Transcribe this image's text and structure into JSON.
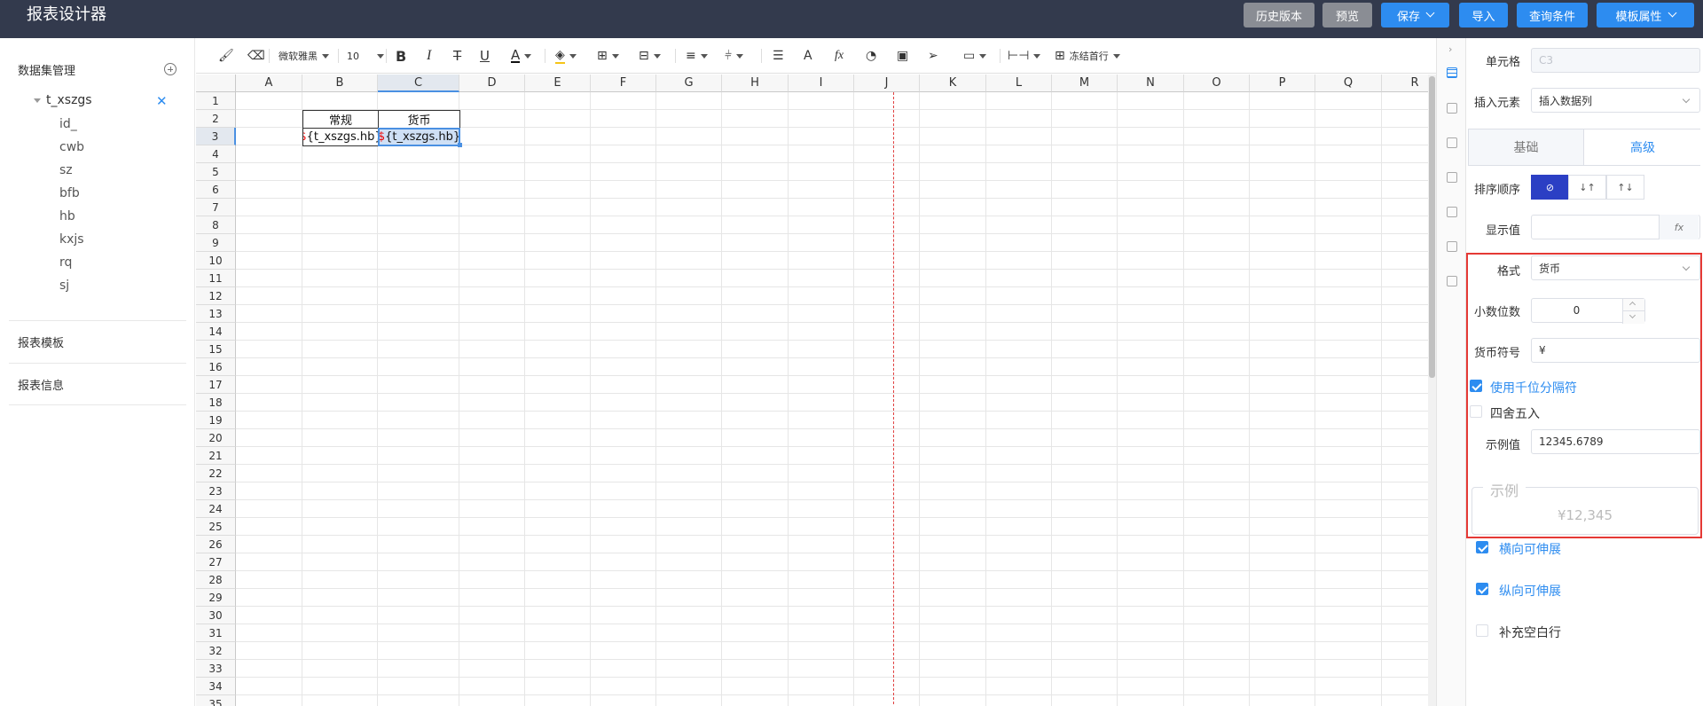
{
  "app": {
    "title": "报表设计器"
  },
  "header_buttons": [
    {
      "label": "历史版本",
      "style": "gray",
      "dropdown": false
    },
    {
      "label": "预览",
      "style": "gray",
      "dropdown": false
    },
    {
      "label": "保存",
      "style": "blue",
      "dropdown": true
    },
    {
      "label": "导入",
      "style": "blue",
      "dropdown": false
    },
    {
      "label": "查询条件",
      "style": "blue",
      "dropdown": false
    },
    {
      "label": "模板属性",
      "style": "blue",
      "dropdown": true
    }
  ],
  "left_panel": {
    "dataset_title": "数据集管理",
    "dataset_name": "t_xszgs",
    "fields": [
      "id_",
      "cwb",
      "sz",
      "bfb",
      "hb",
      "kxjs",
      "rq",
      "sj"
    ],
    "template_title": "报表模板",
    "info_title": "报表信息"
  },
  "toolbar": {
    "font_family": "微软雅黑",
    "font_size": "10",
    "freeze_label": "冻结首行",
    "bold": "B",
    "italic": "I",
    "strike": "T",
    "underline": "U",
    "font_color": "A",
    "text_a": "A",
    "fx": "fx"
  },
  "grid": {
    "columns": [
      "A",
      "B",
      "C",
      "D",
      "E",
      "F",
      "G",
      "H",
      "I",
      "J",
      "K",
      "L",
      "M",
      "N",
      "O",
      "P",
      "Q",
      "R"
    ],
    "rows": [
      "1",
      "2",
      "3",
      "4",
      "5",
      "6",
      "7",
      "8",
      "9",
      "10",
      "11",
      "12",
      "13",
      "14",
      "15",
      "16",
      "17",
      "18",
      "19",
      "20",
      "21",
      "22",
      "23",
      "24",
      "25",
      "26",
      "27",
      "28",
      "29",
      "30",
      "31",
      "32",
      "33",
      "34",
      "35"
    ],
    "selected_column": "C",
    "selected_row": "3",
    "b2": "常规",
    "c2": "货币",
    "b3_prefix": "$",
    "b3_rest": "{t_xszgs.hb}",
    "c3_prefix": "$",
    "c3_rest": "{t_xszgs.hb}"
  },
  "right_panel": {
    "cell_label": "单元格",
    "cell_value": "C3",
    "insert_label": "插入元素",
    "insert_value": "插入数据列",
    "tab_basic": "基础",
    "tab_advanced": "高级",
    "sort_label": "排序顺序",
    "sort_none": "⊘",
    "sort_asc": "↓↑",
    "sort_desc": "↑↓",
    "display_label": "显示值",
    "display_value": "",
    "fx_label": "fx",
    "format_label": "格式",
    "format_value": "货币",
    "decimal_label": "小数位数",
    "decimal_value": "0",
    "currency_label": "货币符号",
    "currency_value": "¥",
    "thousands_label": "使用千位分隔符",
    "thousands_checked": true,
    "round_label": "四舍五入",
    "round_checked": false,
    "sample_label": "示例值",
    "sample_value": "12345.6789",
    "example_legend": "示例",
    "example_value": "¥12,345",
    "h_expand_label": "横向可伸展",
    "h_expand_checked": true,
    "v_expand_label": "纵向可伸展",
    "v_expand_checked": true,
    "fill_blank_label": "补充空白行",
    "fill_blank_checked": false
  },
  "colors": {
    "header_bg": "#333a4d",
    "accent": "#2d8cf0",
    "highlight_border": "#e53935",
    "sort_active": "#2b3fc4"
  }
}
